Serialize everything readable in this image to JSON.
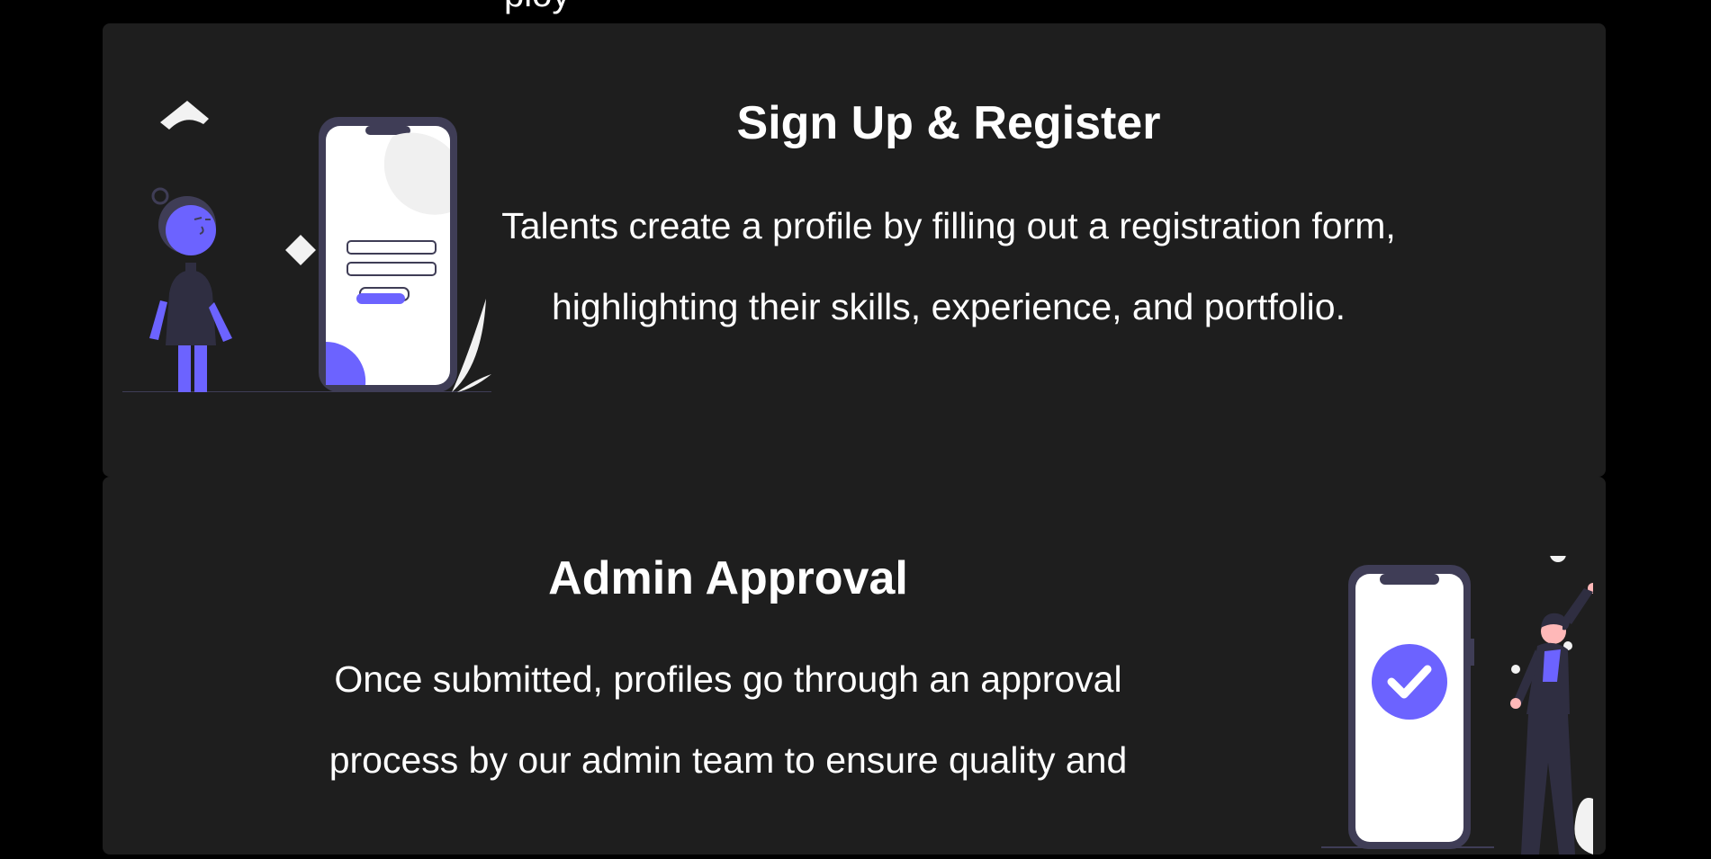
{
  "top_fragment": "ploy",
  "steps": [
    {
      "title": "Sign Up & Register",
      "description": "Talents create a profile by filling out a registration form, highlighting their skills, experience, and portfolio.",
      "illustration": "person-with-phone-registration-form"
    },
    {
      "title": "Admin Approval",
      "description": "Once submitted, profiles go through an approval process by our admin team to ensure quality and",
      "illustration": "person-celebrating-phone-checkmark"
    }
  ],
  "colors": {
    "background": "#000000",
    "card": "#1e1e1e",
    "accent": "#6c63ff",
    "dark_figure": "#3f3d56",
    "skin": "#ffb8b8"
  }
}
